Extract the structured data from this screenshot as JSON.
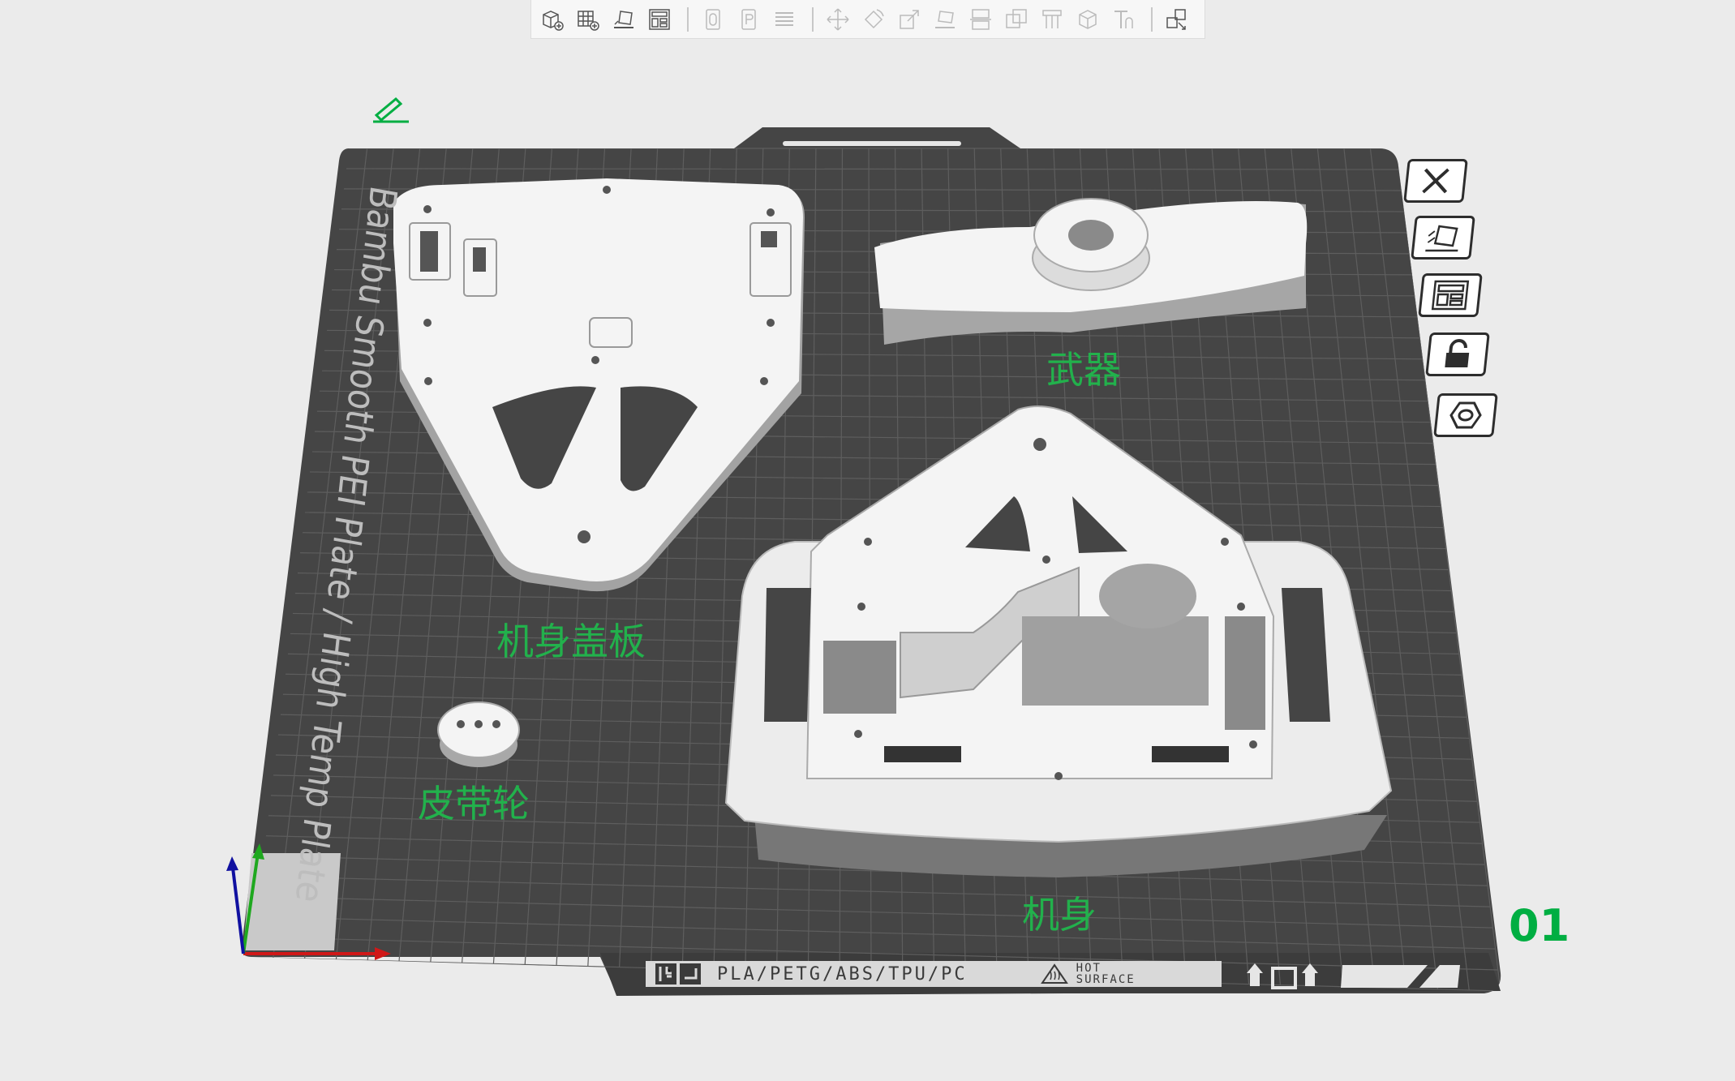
{
  "toolbar": {
    "groups": [
      [
        "add-object-icon",
        "add-plate-icon",
        "auto-orient-icon",
        "arrange-icon"
      ],
      [
        "split-objects-icon",
        "split-parts-icon",
        "layers-icon"
      ],
      [
        "move-icon",
        "rotate-icon",
        "scale-icon",
        "lay-on-face-icon",
        "cut-icon",
        "boolean-icon",
        "support-paint-icon",
        "seam-paint-icon",
        "text-emboss-icon"
      ],
      [
        "assembly-icon"
      ]
    ]
  },
  "plate": {
    "brand_text": "Bambu Smooth PEI Plate / High Temp Plate",
    "number": "01",
    "materials": "PLA/PETG/ABS/TPU/PC",
    "hot_line1": "HOT",
    "hot_line2": "SURFACE",
    "colors": {
      "bed": "#454545",
      "grid": "#5a5a5a",
      "label": "#22b14c",
      "accent": "#00ae42"
    }
  },
  "objects": [
    {
      "label": "武器"
    },
    {
      "label": "机身盖板"
    },
    {
      "label": "皮带轮"
    },
    {
      "label": "机身"
    }
  ],
  "plate_buttons": [
    "close-icon",
    "auto-orient-plate-icon",
    "arrange-plate-icon",
    "lock-icon",
    "settings-hex-icon"
  ]
}
